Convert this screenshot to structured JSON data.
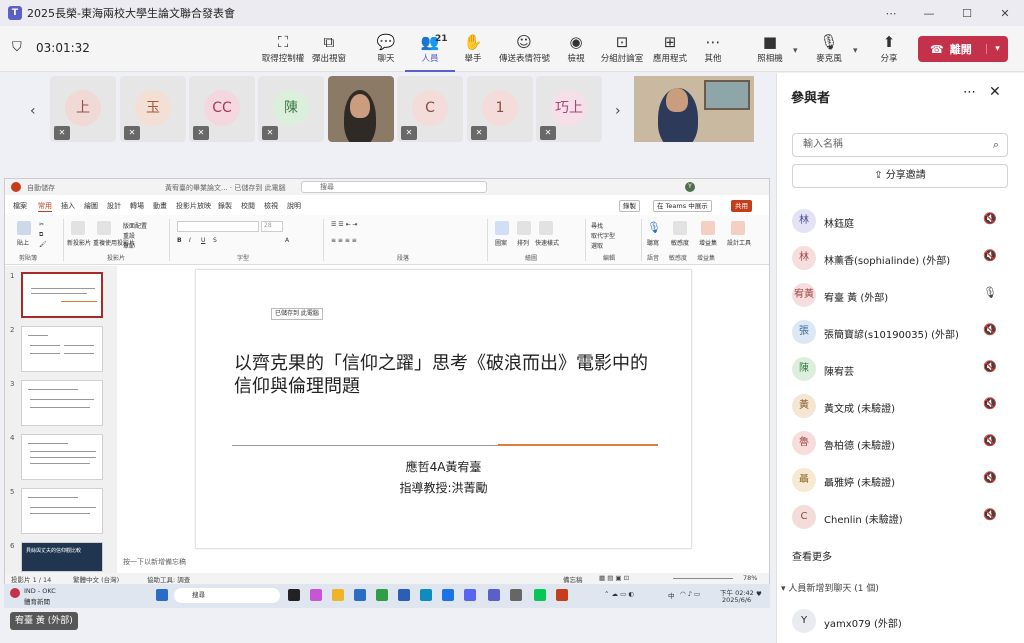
{
  "window": {
    "title": "2025長榮-東海兩校大學生論文聯合發表會",
    "app_icon": "T"
  },
  "toolbar": {
    "timer": "03:01:32",
    "buttons": [
      {
        "label": "取得控制權",
        "icon": "⛶"
      },
      {
        "label": "彈出視窗",
        "icon": "⧉"
      },
      {
        "label": "聊天",
        "icon": "💬"
      },
      {
        "label": "人員",
        "icon": "👥"
      },
      {
        "label": "舉手",
        "icon": "✋"
      },
      {
        "label": "傳送表情符號",
        "icon": "☺"
      },
      {
        "label": "檢視",
        "icon": "◉"
      },
      {
        "label": "分組討論室",
        "icon": "⊡"
      },
      {
        "label": "應用程式",
        "icon": "⊞"
      },
      {
        "label": "其他",
        "icon": "⋯"
      },
      {
        "label": "照相機",
        "icon": "■"
      },
      {
        "label": "麥克風",
        "icon": "🎙"
      },
      {
        "label": "分享",
        "icon": "⬆"
      }
    ],
    "people_count": "21",
    "leave_label": "離開"
  },
  "strip": {
    "tiles": [
      {
        "initial": "上",
        "bg": "#f1d9d6",
        "fg": "#9c4d45"
      },
      {
        "initial": "玉",
        "bg": "#f4dfd5",
        "fg": "#a3573c"
      },
      {
        "initial": "CC",
        "bg": "#f5d7e0",
        "fg": "#a8385e"
      },
      {
        "initial": "陳",
        "bg": "#dcefdd",
        "fg": "#3d7a44"
      },
      {
        "initial": "C",
        "bg": "#f3dcd9",
        "fg": "#8a4a45"
      },
      {
        "initial": "1",
        "bg": "#f3dcd9",
        "fg": "#8a4a45"
      },
      {
        "initial": "巧上",
        "bg": "#f6dfe9",
        "fg": "#a3487a"
      }
    ]
  },
  "ppt": {
    "autosave": "自動儲存",
    "doc_title": "黃宥臺的畢業論文...  · 已儲存到 此電腦",
    "search": "搜尋",
    "user_initial": "Y",
    "tabs": [
      "檔案",
      "常用",
      "插入",
      "繪圖",
      "設計",
      "轉場",
      "動畫",
      "投影片放映",
      "錄製",
      "校閱",
      "檢視",
      "說明"
    ],
    "record_btn": "錄製",
    "teams_btn": "在 Teams 中展示",
    "share_btn": "共用",
    "ribbon_sections": [
      "剪貼簿",
      "投影片",
      "字型",
      "段落",
      "繪圖",
      "編輯",
      "語音",
      "敏感度",
      "增益集"
    ],
    "ribbon_items": {
      "paste": "貼上",
      "new_slide": "新投影片",
      "reuse": "重複使用投影片",
      "layout": "版面配置",
      "reset": "重設",
      "section": "章節",
      "shapes": "圖案",
      "arrange": "排列",
      "quick_styles": "快速樣式",
      "find": "尋找",
      "replace": "取代字型",
      "select": "選取",
      "dictate": "聽寫",
      "sensitivity": "敏感度",
      "addins": "增益集",
      "designer": "設計工具"
    },
    "font_size": "28",
    "tooltip": "已儲存到 此電腦",
    "slide": {
      "title": "以齊克果的「信仰之躍」思考《破浪而出》電影中的信仰與倫理問題",
      "author": "應哲4A黃宥臺",
      "advisor": "指導教授:洪菁勵"
    },
    "thumb_numbers": [
      "1",
      "2",
      "3",
      "4",
      "5",
      "6"
    ],
    "thumb6_text": "貝絲與丈夫的信仰觀比較",
    "notes": "按一下以新增備忘稿",
    "status": {
      "slide": "投影片 1 / 14",
      "lang": "繁體中文 (台灣)",
      "access": "協助工具: 調查",
      "notes": "備忘稿",
      "zoom": "78%"
    }
  },
  "taskbar": {
    "weather": "IND - OKC",
    "weather_sub": "體育新聞",
    "search": "搜尋",
    "lang": "中",
    "time": "下午 02:42",
    "date": "2025/6/6"
  },
  "name_tag": "宥臺 黃 (外部)",
  "panel": {
    "title": "參與者",
    "search_placeholder": "輸入名稱",
    "share_invite": "分享邀請",
    "participants": [
      {
        "initial": "林",
        "name": "林鈺庭",
        "bg": "#e3e3f5",
        "fg": "#4b4b9a",
        "mic": "muted"
      },
      {
        "initial": "林",
        "name": "林薰香(sophialinde) (外部)",
        "bg": "#f6dede",
        "fg": "#a04848",
        "mic": "muted"
      },
      {
        "initial": "宥黃",
        "name": "宥臺 黃 (外部)",
        "bg": "#f6dede",
        "fg": "#a04848",
        "mic": "on"
      },
      {
        "initial": "張",
        "name": "張簡寶諺(s10190035) (外部)",
        "bg": "#dde8f5",
        "fg": "#3d6697",
        "mic": "muted"
      },
      {
        "initial": "陳",
        "name": "陳宥芸",
        "bg": "#dcefdd",
        "fg": "#3d7a44",
        "mic": "muted"
      },
      {
        "initial": "黃",
        "name": "黃文成 (未驗證)",
        "bg": "#f5e6d3",
        "fg": "#8a5b2a",
        "mic": "muted"
      },
      {
        "initial": "魯",
        "name": "魯柏德 (未驗證)",
        "bg": "#f7dddc",
        "fg": "#a04848",
        "mic": "muted"
      },
      {
        "initial": "聶",
        "name": "聶雅婷 (未驗證)",
        "bg": "#f7ead3",
        "fg": "#8a6a2a",
        "mic": "muted"
      },
      {
        "initial": "C",
        "name": "Chenlin (未驗證)",
        "bg": "#f3dcd9",
        "fg": "#8a4a45",
        "mic": "muted"
      }
    ],
    "see_more": "查看更多",
    "section_chat": "人員新增到聊天 (1 個)",
    "chat_user": {
      "initial": "Y",
      "name": "yamx079 (外部)"
    }
  }
}
